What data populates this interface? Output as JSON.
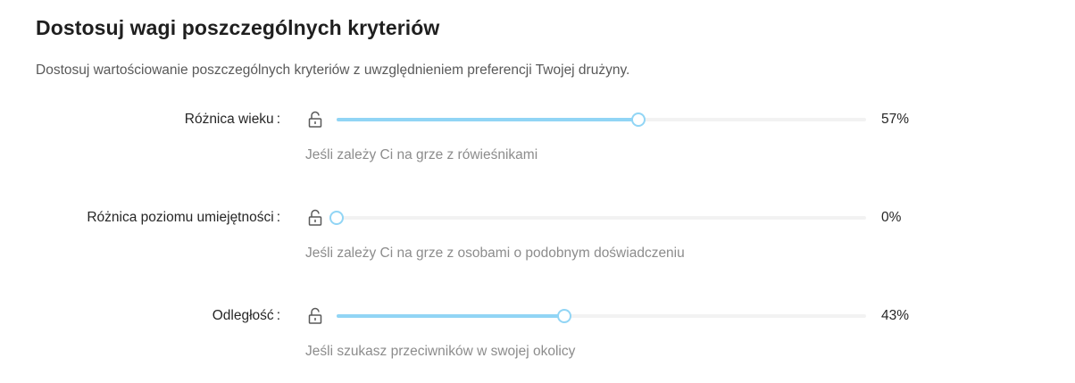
{
  "header": {
    "title": "Dostosuj wagi poszczególnych kryteriów",
    "subtitle": "Dostosuj wartościowanie poszczególnych kryteriów z uwzględnieniem preferencji Twojej drużyny."
  },
  "criteria": [
    {
      "label": "Różnica wieku",
      "colon": ":",
      "value": 57,
      "value_text": "57%",
      "hint": "Jeśli zależy Ci na grze z rówieśnikami",
      "lock_icon": "unlock-icon"
    },
    {
      "label": "Różnica poziomu umiejętności",
      "colon": ":",
      "value": 0,
      "value_text": "0%",
      "hint": "Jeśli zależy Ci na grze z osobami o podobnym doświadczeniu",
      "lock_icon": "unlock-icon"
    },
    {
      "label": "Odległość",
      "colon": ":",
      "value": 43,
      "value_text": "43%",
      "hint": "Jeśli szukasz przeciwników w swojej okolicy",
      "lock_icon": "unlock-icon"
    }
  ],
  "colors": {
    "slider_fill": "#91d5f5",
    "slider_track": "#f2f2f2",
    "hint_text": "#8c8c8c"
  }
}
